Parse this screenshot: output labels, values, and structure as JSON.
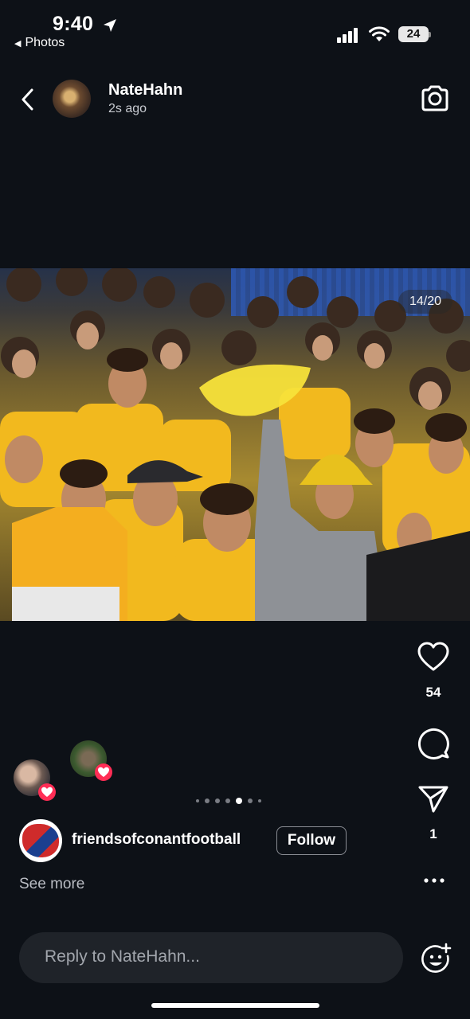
{
  "status_bar": {
    "time": "9:40",
    "back_app": "Photos",
    "battery": "24"
  },
  "header": {
    "username": "NateHahn",
    "time_ago": "2s ago"
  },
  "photo": {
    "counter": "14/20"
  },
  "actions": {
    "like_count": "54",
    "send_count": "1"
  },
  "carousel": {
    "total_dots": 7,
    "active_index": 4
  },
  "account": {
    "name": "friendsofconantfootball",
    "follow_label": "Follow",
    "see_more": "See more"
  },
  "reply": {
    "placeholder": "Reply to NateHahn..."
  },
  "colors": {
    "background": "#0d1117",
    "heart_reaction": "#ff2d55",
    "school_yellow": "#f2b91e"
  },
  "icons": [
    "location-arrow-icon",
    "signal-icon",
    "wifi-icon",
    "battery-icon",
    "back-chevron-icon",
    "camera-icon",
    "heart-icon",
    "comment-icon",
    "send-icon",
    "more-icon",
    "emoji-add-icon"
  ]
}
